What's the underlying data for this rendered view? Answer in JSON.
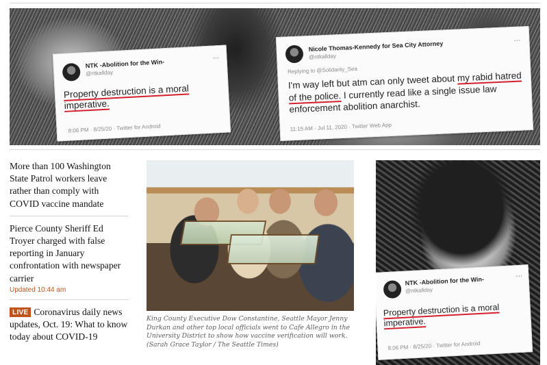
{
  "hero": {
    "tweet_left": {
      "name": "NTK -Abolition for the Win-",
      "handle": "@ntkallday",
      "body_underlined": "Property destruction is a moral imperative.",
      "meta": "8:06 PM · 8/25/20 · Twitter for Android"
    },
    "tweet_right": {
      "name": "Nicole Thomas-Kennedy for Sea City Attorney",
      "handle": "@ntkallday",
      "replying_to": "Replying to @Solidarity_Sea",
      "body_before": "I'm way left but atm can only tweet about ",
      "body_underlined": "my rabid hatred of the police.",
      "body_after": " I currently read like a single issue law enforcement abolition anarchist.",
      "meta": "11:15 AM · Jul 11, 2020 · Twitter Web App"
    }
  },
  "headlines": [
    {
      "text": "More than 100 Washington State Patrol workers leave rather than comply with COVID vaccine mandate"
    },
    {
      "text": "Pierce County Sheriff Ed Troyer charged with false reporting in January confrontation with newspaper carrier",
      "updated": "Updated 10:44 am"
    },
    {
      "live": "LIVE",
      "text": "Coronavirus daily news updates, Oct. 19: What to know today about COVID-19"
    }
  ],
  "photo": {
    "caption": "King County Executive Dow Constantine, Seattle Mayor Jenny Durkan and other top local officials went to Cafe Allegro in the University District to show how vaccine verification will work. (Sarah Grace Taylor / The Seattle Times)"
  },
  "right_image": {
    "tweet": {
      "name": "NTK -Abolition for the Win-",
      "handle": "@ntkallday",
      "body_underlined": "Property destruction is a moral imperative.",
      "meta": "8:06 PM · 8/25/20 · Twitter for Android"
    }
  },
  "icons": {
    "more": "more-dots-icon",
    "avatar": "avatar"
  },
  "colors": {
    "underline": "#d4202c",
    "live_badge": "#c0531c",
    "updated": "#c0531c"
  }
}
